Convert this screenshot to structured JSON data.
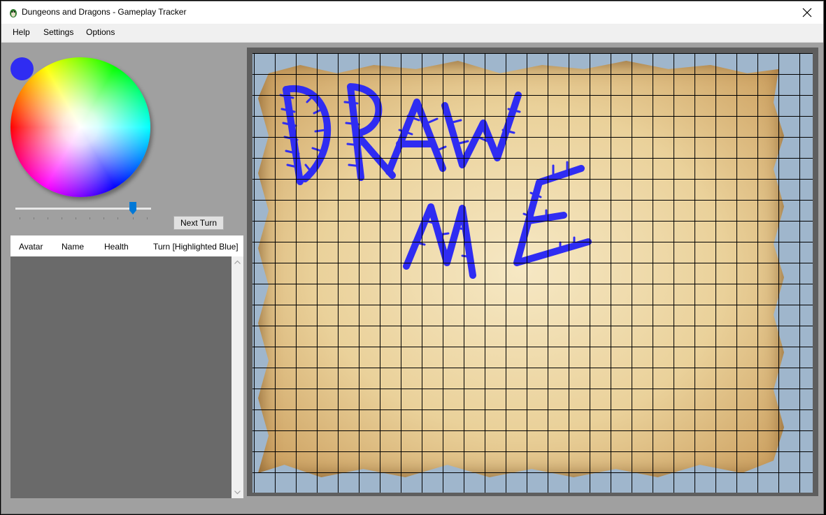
{
  "window": {
    "title": "Dungeons and Dragons - Gameplay Tracker",
    "close_symbol": "✕"
  },
  "menu": {
    "items": [
      {
        "label": "Help"
      },
      {
        "label": "Settings"
      },
      {
        "label": "Options"
      }
    ]
  },
  "color_picker": {
    "selected_color": "#2f2cf2",
    "brightness_level": 0.87
  },
  "turn": {
    "next_turn_label": "Next Turn"
  },
  "players_table": {
    "columns": [
      "Avatar",
      "Name",
      "Health",
      "Turn [Highlighted Blue]"
    ],
    "rows": []
  },
  "map": {
    "drawing_color": "#2f2cf2",
    "background_color": "#9fb6cc",
    "frame_color": "#5e5e5e"
  },
  "icons": {
    "app": "app-icon",
    "close": "close-icon",
    "scroll_up": "chevron-up-icon",
    "scroll_down": "chevron-down-icon"
  }
}
